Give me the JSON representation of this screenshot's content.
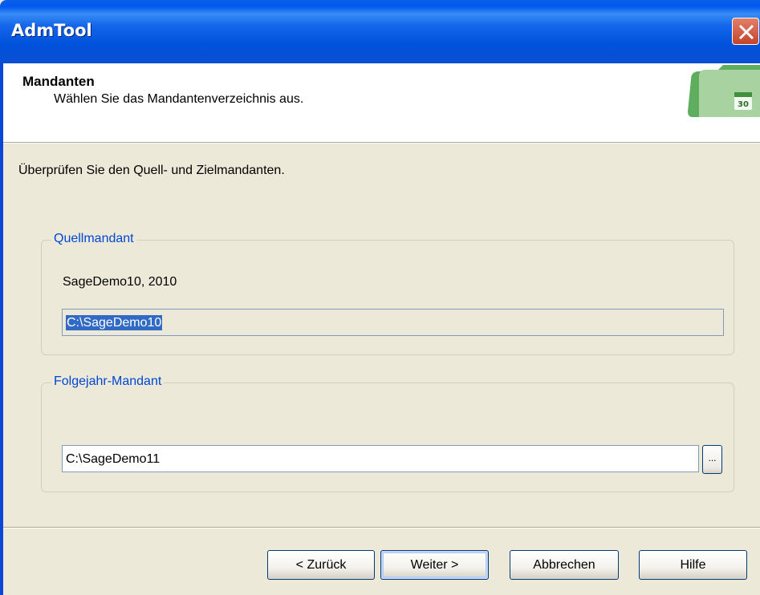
{
  "window": {
    "title": "AdmTool"
  },
  "header": {
    "title": "Mandanten",
    "subtitle": "Wählen Sie das Mandantenverzeichnis aus.",
    "icon": "folder-calendar-icon",
    "icon_badge": "30"
  },
  "intro_text": "Überprüfen Sie den Quell- und Zielmandanten.",
  "source": {
    "legend": "Quellmandant",
    "name": "SageDemo10, 2010",
    "path": "C:\\SageDemo10"
  },
  "target": {
    "legend": "Folgejahr-Mandant",
    "path": "C:\\SageDemo11",
    "browse_label": "..."
  },
  "buttons": {
    "back": "< Zurück",
    "next": "Weiter >",
    "cancel": "Abbrechen",
    "help": "Hilfe"
  },
  "colors": {
    "titlebar": "#0054e3",
    "legend_text": "#0046d5",
    "selection": "#316ac5",
    "close_button": "#d5533a"
  }
}
